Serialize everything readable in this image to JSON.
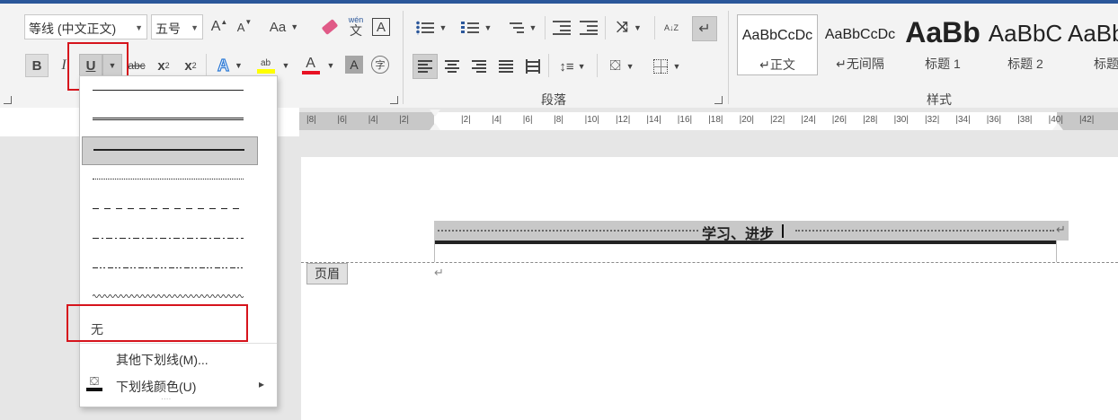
{
  "font": {
    "name": "等线 (中文正文)",
    "size": "五号",
    "grow_glyph": "A",
    "shrink_glyph": "A",
    "change_case_glyph": "Aa",
    "phonetic_top": "wén",
    "phonetic_bottom": "文",
    "border_glyph": "A"
  },
  "format_buttons": {
    "bold": "B",
    "italic": "I",
    "underline": "U",
    "strikethrough": "abc",
    "subscript": "x",
    "subscript_mark": "2",
    "superscript": "x",
    "superscript_mark": "2",
    "text_effects": "A",
    "highlight_top": "ab",
    "font_color": "A",
    "char_shading": "A",
    "enclose_char": "字"
  },
  "colors": {
    "highlight": "#ffff00",
    "font_color": "#e81123",
    "accent": "#2b579a",
    "red_annotation": "#d6141c"
  },
  "paragraph": {
    "group_label": "段落",
    "sort_label": "A↓Z"
  },
  "styles": {
    "group_label": "样式",
    "items": [
      {
        "sample": "AaBbCcDc",
        "name": "↵正文"
      },
      {
        "sample": "AaBbCcDc",
        "name": "↵无间隔"
      },
      {
        "sample": "AaBb",
        "name": "标题 1"
      },
      {
        "sample": "AaBbC",
        "name": "标题 2"
      },
      {
        "sample": "AaBb",
        "name": "标题"
      }
    ]
  },
  "ruler": {
    "labels": [
      "8",
      "6",
      "4",
      "2",
      "",
      "2",
      "4",
      "6",
      "8",
      "10",
      "12",
      "14",
      "16",
      "18",
      "20",
      "22",
      "24",
      "26",
      "28",
      "30",
      "32",
      "34",
      "36",
      "38",
      "40",
      "42"
    ]
  },
  "document": {
    "header_text": "学习、进步",
    "header_tag": "页眉",
    "return_mark": "↵"
  },
  "underline_menu": {
    "none_label": "无",
    "more_label": "其他下划线(M)...",
    "more_accel": "M",
    "color_label": "下划线颜色(U)",
    "color_accel": "U",
    "submenu_arrow": "▸",
    "grip": "· · · ·",
    "options": [
      "single",
      "double",
      "thick",
      "dotted",
      "dash",
      "dash-dot",
      "dash-dot-dot",
      "wave"
    ],
    "selected": "thick"
  }
}
